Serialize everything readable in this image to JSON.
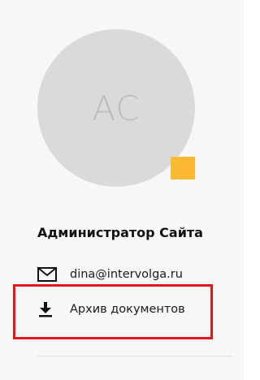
{
  "profile": {
    "initials": "AC",
    "name": "Администратор Сайта",
    "status_color": "#fbb932"
  },
  "contacts": {
    "email": "dina@intervolga.ru",
    "email_icon": "envelope-icon"
  },
  "actions": {
    "archive_label": "Архив документов",
    "archive_icon": "download-icon"
  },
  "colors": {
    "highlight": "#e4161b",
    "avatar_bg": "#dadada"
  }
}
